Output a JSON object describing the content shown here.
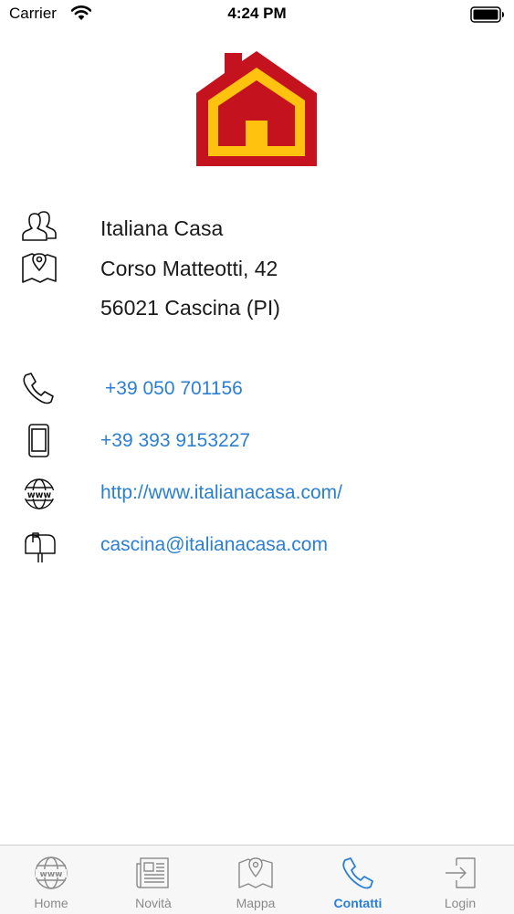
{
  "status_bar": {
    "carrier": "Carrier",
    "time": "4:24 PM"
  },
  "contact": {
    "name": "Italiana Casa",
    "street": "Corso Matteotti, 42",
    "city": "56021 Cascina (PI)",
    "phone": "+39 050 701156",
    "mobile": "+39 393 9153227",
    "website": "http://www.italianacasa.com/",
    "email": "cascina@italianacasa.com"
  },
  "tab_bar": {
    "tabs": [
      {
        "label": "Home",
        "icon": "globe-www-icon"
      },
      {
        "label": "Novità",
        "icon": "newspaper-icon"
      },
      {
        "label": "Mappa",
        "icon": "map-pin-icon"
      },
      {
        "label": "Contatti",
        "icon": "phone-icon"
      },
      {
        "label": "Login",
        "icon": "login-icon"
      }
    ],
    "active": "Contatti"
  },
  "colors": {
    "link": "#2a7fd4",
    "logo_red": "#c4121f",
    "logo_yellow": "#ffc20e",
    "tab_inactive": "#8a8a8a"
  }
}
